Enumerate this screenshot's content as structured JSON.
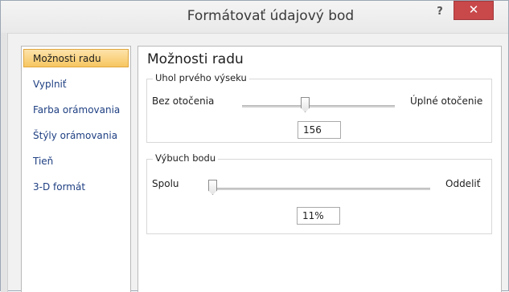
{
  "window": {
    "title": "Formátovať údajový bod",
    "help_label": "?",
    "close_label": "✕"
  },
  "sidebar": {
    "items": [
      {
        "label": "Možnosti radu",
        "active": true
      },
      {
        "label": "Vyplniť",
        "active": false
      },
      {
        "label": "Farba orámovania",
        "active": false
      },
      {
        "label": "Štýly orámovania",
        "active": false
      },
      {
        "label": "Tieň",
        "active": false
      },
      {
        "label": "3-D formát",
        "active": false
      }
    ]
  },
  "panel": {
    "title": "Možnosti radu",
    "angle_group": {
      "label": "Uhol prvého výseku",
      "min_label": "Bez otočenia",
      "max_label": "Úplné otočenie",
      "value": "156"
    },
    "explosion_group": {
      "label": "Výbuch bodu",
      "min_label": "Spolu",
      "max_label": "Oddeliť",
      "value": "11%"
    }
  },
  "colors": {
    "active_item": "#f7c660",
    "close_button": "#c9484a",
    "link_text": "#1e3f82"
  }
}
